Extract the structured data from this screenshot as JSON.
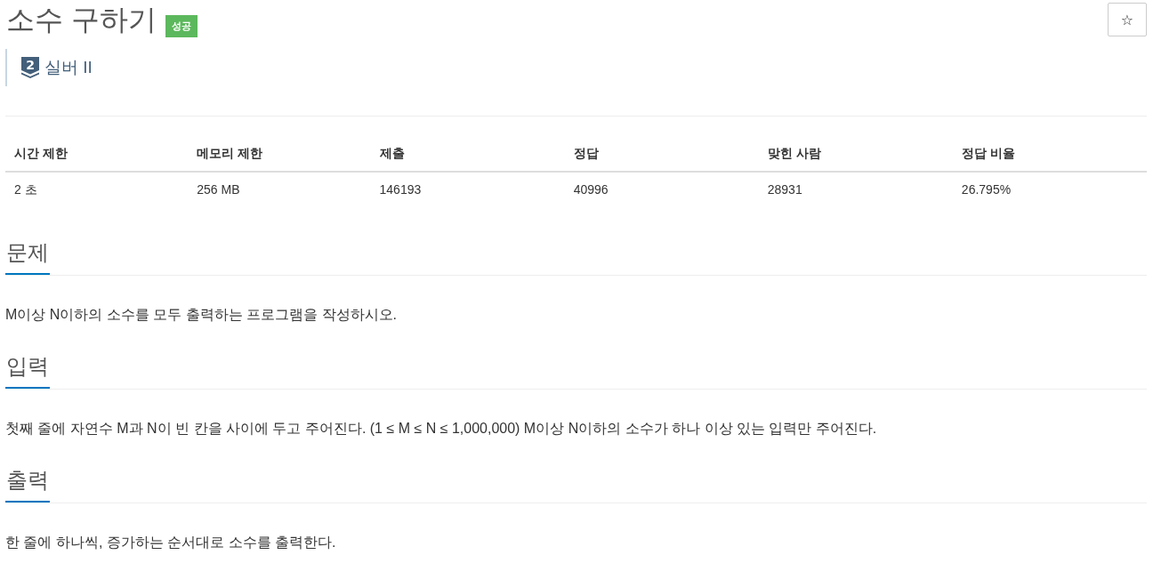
{
  "header": {
    "title": "소수 구하기",
    "result_badge": "성공",
    "favorite_button": "☆"
  },
  "tier": {
    "level": "2",
    "name": "실버 II"
  },
  "limits_table": {
    "columns": [
      "시간 제한",
      "메모리 제한",
      "제출",
      "정답",
      "맞힌 사람",
      "정답 비율"
    ],
    "rows": [
      [
        "2 초",
        "256 MB",
        "146193",
        "40996",
        "28931",
        "26.795%"
      ]
    ]
  },
  "sections": [
    {
      "heading": "문제",
      "body": "M이상 N이하의 소수를 모두 출력하는 프로그램을 작성하시오."
    },
    {
      "heading": "입력",
      "body": "첫째 줄에 자연수 M과 N이 빈 칸을 사이에 두고 주어진다. (1 ≤ M ≤ N ≤ 1,000,000) M이상 N이하의 소수가 하나 이상 있는 입력만 주어진다."
    },
    {
      "heading": "출력",
      "body": "한 줄에 하나씩, 증가하는 순서대로 소수를 출력한다."
    }
  ]
}
